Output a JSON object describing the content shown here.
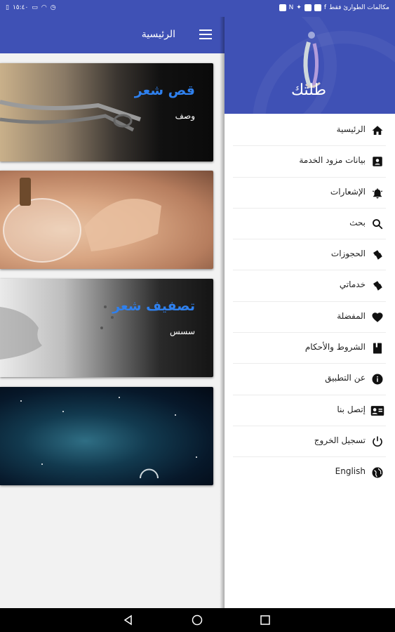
{
  "status_bar": {
    "time": "١٥:٤٠",
    "carrier_text": "مكالمات الطوارئ فقط",
    "icons": [
      "vibrate-icon",
      "battery-icon",
      "wifi-icon",
      "alarm-icon",
      "nfc-icon",
      "app-notification-icons"
    ]
  },
  "main": {
    "title": "الرئيسية",
    "cards": [
      {
        "title": "قص شعر",
        "description": "وصف"
      },
      {
        "title": "",
        "description": ""
      },
      {
        "title": "تصفيف شعر",
        "description": "سسس"
      },
      {
        "title": "",
        "description": ""
      }
    ]
  },
  "drawer": {
    "logo_text": "طلتك",
    "items": [
      {
        "label": "الرئيسية",
        "icon": "home-icon"
      },
      {
        "label": "بيانات مزود الخدمة",
        "icon": "contact-card-icon"
      },
      {
        "label": "الإشعارات",
        "icon": "bell-icon"
      },
      {
        "label": "بحث",
        "icon": "search-icon"
      },
      {
        "label": "الحجوزات",
        "icon": "tickets-icon"
      },
      {
        "label": "خدماتي",
        "icon": "tickets-icon"
      },
      {
        "label": "المفضلة",
        "icon": "heart-icon"
      },
      {
        "label": "الشروط والأحكام",
        "icon": "book-icon"
      },
      {
        "label": "عن التطبيق",
        "icon": "info-icon"
      },
      {
        "label": "إتصل بنا",
        "icon": "contact-icon"
      },
      {
        "label": "تسجيل الخروج",
        "icon": "power-icon"
      },
      {
        "label": "English",
        "icon": "globe-icon"
      }
    ]
  },
  "colors": {
    "primary": "#3f51b5",
    "card_title": "#2f80ed"
  }
}
